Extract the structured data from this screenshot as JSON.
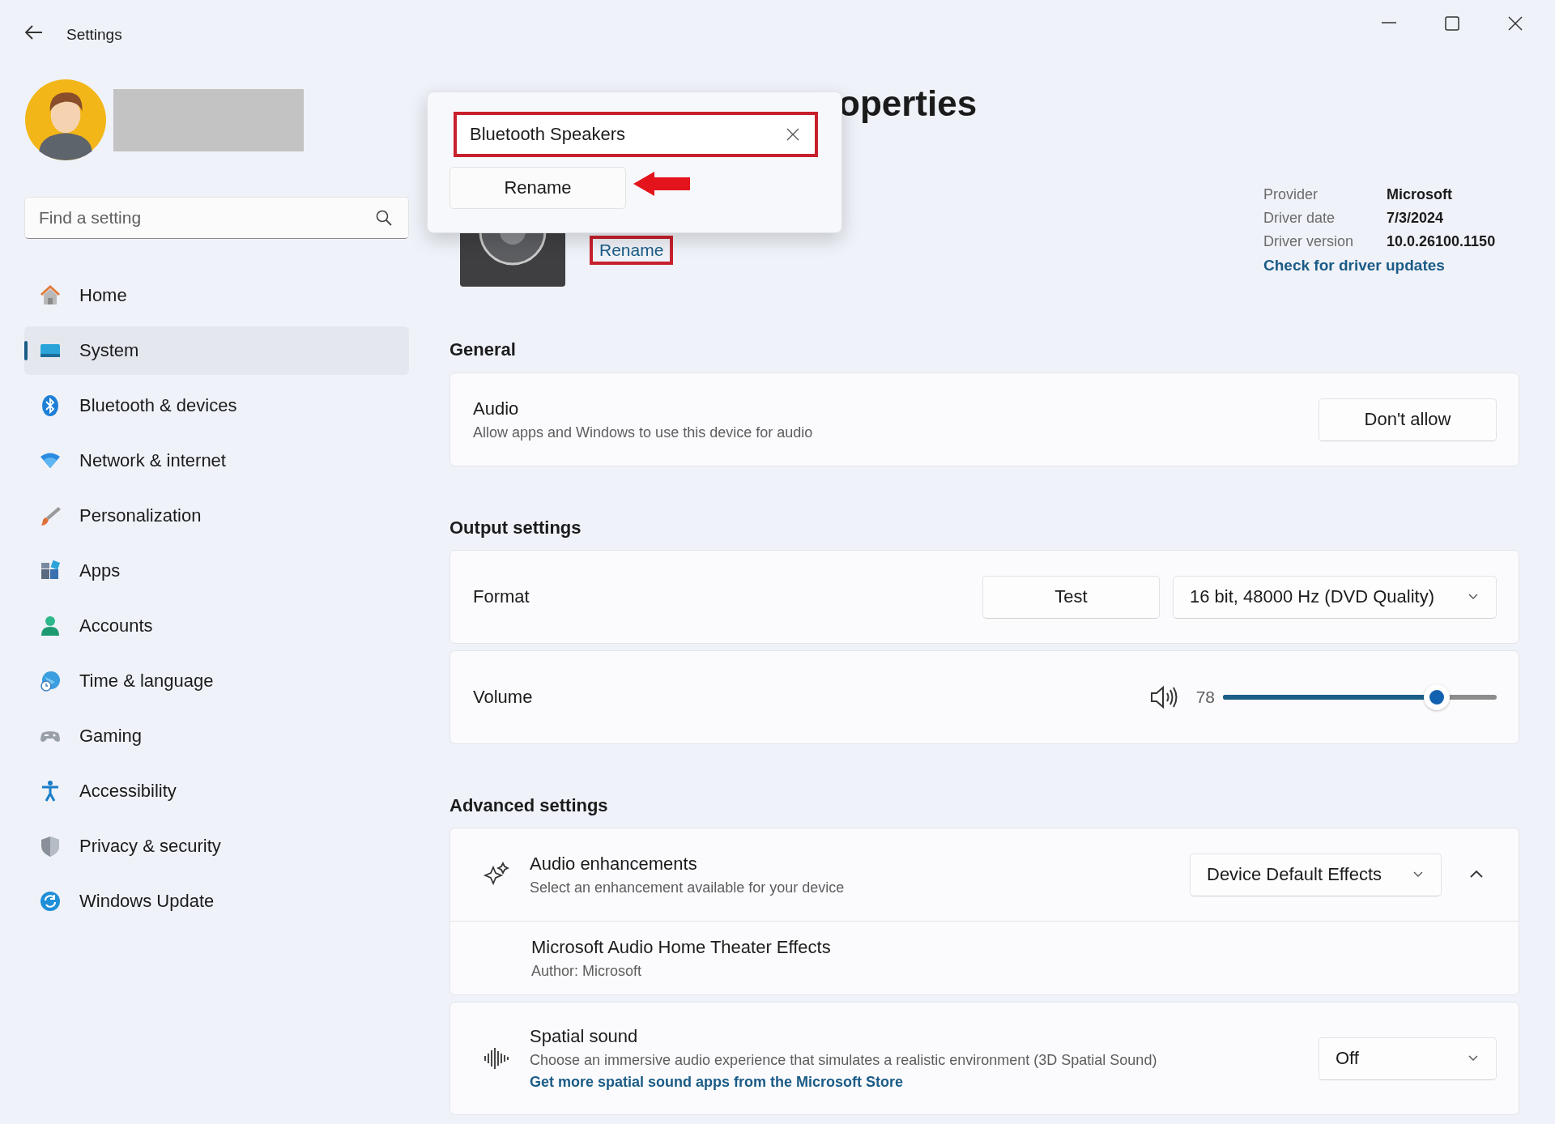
{
  "window": {
    "title": "Settings"
  },
  "search": {
    "placeholder": "Find a setting"
  },
  "sidebar": {
    "items": [
      {
        "label": "Home",
        "kind": "home",
        "selected": false
      },
      {
        "label": "System",
        "kind": "system",
        "selected": true
      },
      {
        "label": "Bluetooth & devices",
        "kind": "bluetooth",
        "selected": false
      },
      {
        "label": "Network & internet",
        "kind": "network",
        "selected": false
      },
      {
        "label": "Personalization",
        "kind": "brush",
        "selected": false
      },
      {
        "label": "Apps",
        "kind": "apps",
        "selected": false
      },
      {
        "label": "Accounts",
        "kind": "accounts",
        "selected": false
      },
      {
        "label": "Time & language",
        "kind": "time",
        "selected": false
      },
      {
        "label": "Gaming",
        "kind": "gaming",
        "selected": false
      },
      {
        "label": "Accessibility",
        "kind": "accessibility",
        "selected": false
      },
      {
        "label": "Privacy & security",
        "kind": "privacy",
        "selected": false
      },
      {
        "label": "Windows Update",
        "kind": "update",
        "selected": false
      }
    ]
  },
  "page": {
    "title": "operties"
  },
  "rename_popup": {
    "value": "Bluetooth Speakers",
    "highlighted": true,
    "button": "Rename",
    "pointed": true
  },
  "device": {
    "rename_link": "Rename",
    "highlighted": true
  },
  "driver_info": [
    {
      "label": "Provider",
      "value": "Microsoft"
    },
    {
      "label": "Driver date",
      "value": "7/3/2024"
    },
    {
      "label": "Driver version",
      "value": "10.0.26100.1150"
    }
  ],
  "driver_link": "Check for driver updates",
  "sections": [
    {
      "heading": "General",
      "cards": [
        {
          "kind": "button",
          "title": "Audio",
          "description": "Allow apps and Windows to use this device for audio",
          "button": "Don't allow"
        }
      ]
    },
    {
      "heading": "Output settings",
      "cards": [
        {
          "kind": "format",
          "title": "Format",
          "button": "Test",
          "dropdown": "16 bit, 48000 Hz (DVD Quality)"
        },
        {
          "kind": "volume",
          "title": "Volume",
          "reading": "78",
          "level": 0.78
        }
      ]
    },
    {
      "heading": "Advanced settings",
      "cards": [
        {
          "kind": "expander",
          "title": "Audio enhancements",
          "description": "Select an enhancement available for your device",
          "dropdown": "Device Default Effects",
          "expanded": true,
          "children": [
            {
              "title": "Microsoft Audio Home Theater Effects",
              "description": "Author: Microsoft"
            }
          ]
        },
        {
          "kind": "spatial",
          "title": "Spatial sound",
          "description": "Choose an immersive audio experience that simulates a realistic environment (3D Spatial Sound)",
          "link": "Get more spatial sound apps from the Microsoft Store",
          "dropdown": "Off"
        }
      ]
    }
  ]
}
